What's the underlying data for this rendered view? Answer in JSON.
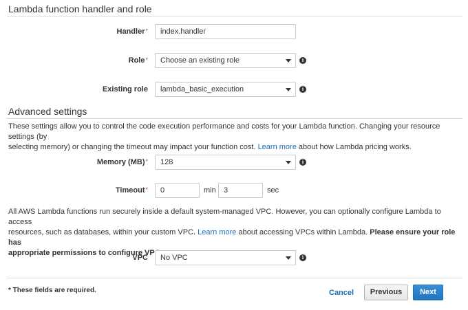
{
  "handler_section": {
    "title": "Lambda function handler and role",
    "handler_label": "Handler",
    "handler_value": "index.handler",
    "role_label": "Role",
    "role_value": "Choose an existing role",
    "existing_role_label": "Existing role",
    "existing_role_value": "lambda_basic_execution",
    "required_mark": "*"
  },
  "advanced": {
    "title": "Advanced settings",
    "desc_line1": "These settings allow you to control the code execution performance and costs for your Lambda function. Changing your resource settings (by",
    "desc_line2_pre": "selecting memory) or changing the timeout may impact your function cost.",
    "desc_link": "Learn more",
    "desc_line2_post": "about how Lambda pricing works.",
    "memory_label": "Memory (MB)",
    "memory_value": "128",
    "timeout_label": "Timeout",
    "timeout_min_value": "0",
    "timeout_min_unit": "min",
    "timeout_sec_value": "3",
    "timeout_sec_unit": "sec",
    "vpc_line1": "All AWS Lambda functions run securely inside a default system-managed VPC. However, you can optionally configure Lambda to access",
    "vpc_line2_pre": "resources, such as databases, within your custom VPC.",
    "vpc_link": "Learn more",
    "vpc_line2_mid": "about accessing VPCs within Lambda.",
    "vpc_line2_bold": "Please ensure your role has",
    "vpc_line3_bold": "appropriate permissions to configure VPC.",
    "vpc_label": "VPC",
    "vpc_value": "No VPC"
  },
  "footer": {
    "required_note": "* These fields are required.",
    "cancel_label": "Cancel",
    "previous_label": "Previous",
    "next_label": "Next"
  },
  "icons": {
    "info": "info-icon",
    "caret": "chevron-down-icon"
  },
  "colors": {
    "link": "#1a6fb8",
    "primary_button": "#1f74bd",
    "required": "#c7402b"
  }
}
